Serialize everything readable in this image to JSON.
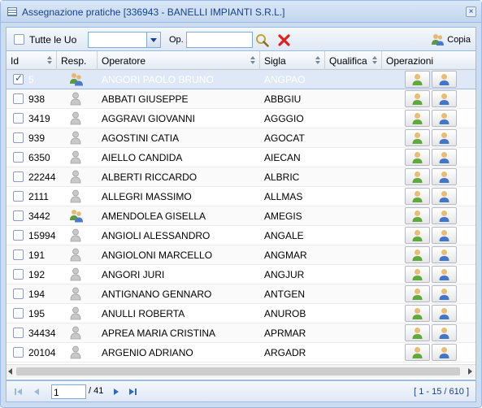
{
  "window": {
    "title": "Assegnazione pratiche [336943 - BANELLI IMPIANTI S.R.L.]",
    "close_label": "×"
  },
  "toolbar": {
    "all_uo_label": "Tutte le Uo",
    "uo_value": "",
    "op_label": "Op.",
    "op_value": "",
    "copy_label": "Copia"
  },
  "grid": {
    "columns": [
      "Id",
      "Resp.",
      "Operatore",
      "Sigla",
      "Qualifica",
      "Operazioni"
    ],
    "rows": [
      {
        "id": "5",
        "operator": "ANGORI PAOLO BRUNO",
        "sigla": "ANGPAO",
        "qualifica": "",
        "checked": true,
        "resp": true,
        "selected": true
      },
      {
        "id": "938",
        "operator": "ABBATI GIUSEPPE",
        "sigla": "ABBGIU",
        "qualifica": "",
        "checked": false,
        "resp": false,
        "selected": false
      },
      {
        "id": "3419",
        "operator": "AGGRAVI GIOVANNI",
        "sigla": "AGGGIO",
        "qualifica": "",
        "checked": false,
        "resp": false,
        "selected": false
      },
      {
        "id": "939",
        "operator": "AGOSTINI CATIA",
        "sigla": "AGOCAT",
        "qualifica": "",
        "checked": false,
        "resp": false,
        "selected": false
      },
      {
        "id": "6350",
        "operator": "AIELLO CANDIDA",
        "sigla": "AIECAN",
        "qualifica": "",
        "checked": false,
        "resp": false,
        "selected": false
      },
      {
        "id": "22244",
        "operator": "ALBERTI RICCARDO",
        "sigla": "ALBRIC",
        "qualifica": "",
        "checked": false,
        "resp": false,
        "selected": false
      },
      {
        "id": "2111",
        "operator": "ALLEGRI MASSIMO",
        "sigla": "ALLMAS",
        "qualifica": "",
        "checked": false,
        "resp": false,
        "selected": false
      },
      {
        "id": "3442",
        "operator": "AMENDOLEA GISELLA",
        "sigla": "AMEGIS",
        "qualifica": "",
        "checked": false,
        "resp": true,
        "selected": false
      },
      {
        "id": "15994",
        "operator": "ANGIOLI ALESSANDRO",
        "sigla": "ANGALE",
        "qualifica": "",
        "checked": false,
        "resp": false,
        "selected": false
      },
      {
        "id": "191",
        "operator": "ANGIOLONI MARCELLO",
        "sigla": "ANGMAR",
        "qualifica": "",
        "checked": false,
        "resp": false,
        "selected": false
      },
      {
        "id": "192",
        "operator": "ANGORI JURI",
        "sigla": "ANGJUR",
        "qualifica": "",
        "checked": false,
        "resp": false,
        "selected": false
      },
      {
        "id": "194",
        "operator": "ANTIGNANO GENNARO",
        "sigla": "ANTGEN",
        "qualifica": "",
        "checked": false,
        "resp": false,
        "selected": false
      },
      {
        "id": "195",
        "operator": "ANULLI ROBERTA",
        "sigla": "ANUROB",
        "qualifica": "",
        "checked": false,
        "resp": false,
        "selected": false
      },
      {
        "id": "34434",
        "operator": "APREA MARIA CRISTINA",
        "sigla": "APRMAR",
        "qualifica": "",
        "checked": false,
        "resp": false,
        "selected": false
      },
      {
        "id": "20104",
        "operator": "ARGENIO ADRIANO",
        "sigla": "ARGADR",
        "qualifica": "",
        "checked": false,
        "resp": false,
        "selected": false
      }
    ]
  },
  "pager": {
    "page": "1",
    "of_label": "/ 41",
    "info": "[ 1 - 15 / 610 ]"
  },
  "colors": {
    "accent": "#15428b",
    "frame": "#99bbe8",
    "selected_row": "#dfe8f6"
  },
  "icons": {
    "title": "grid-window-icon",
    "search": "search-icon",
    "clear": "clear-red-x-icon",
    "copy": "users-copy-icon",
    "user_gray": "user-gray-icon",
    "user_responsible": "user-group-icon",
    "op_assign": "user-green-icon",
    "op_remove": "user-blue-icon"
  }
}
